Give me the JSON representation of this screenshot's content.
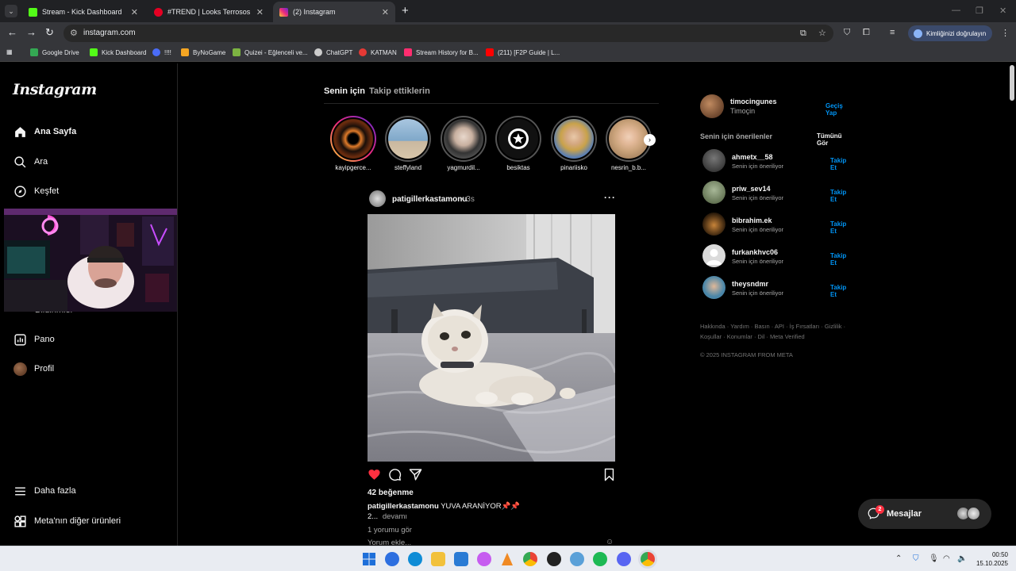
{
  "browser": {
    "tabs": [
      {
        "title": "Stream - Kick Dashboard",
        "favicon_color": "#53fc18",
        "active": false
      },
      {
        "title": "#TREND | Looks Terrosos para",
        "favicon_color": "#e60023",
        "active": false
      },
      {
        "title": "(2) Instagram",
        "favicon_color": "#e1306c",
        "active": true
      }
    ],
    "new_tab": "+",
    "url": "instagram.com",
    "profile_button": "Kimliğinizi doğrulayın",
    "bookmarks": [
      {
        "label": "Google Drive",
        "color": "#34a853"
      },
      {
        "label": "Kick Dashboard",
        "color": "#53fc18"
      },
      {
        "label": "!!!!",
        "color": "#4a6cf7"
      },
      {
        "label": "ByNoGame",
        "color": "#f5a623"
      },
      {
        "label": "Quizei - Eğlenceli ve...",
        "color": "#7cb342"
      },
      {
        "label": "ChatGPT",
        "color": "#cccccc"
      },
      {
        "label": "KATMAN",
        "color": "#e53935"
      },
      {
        "label": "Stream History for B...",
        "color": "#ff2d6f"
      },
      {
        "label": "(211) [F2P Guide | L...",
        "color": "#ff0000"
      }
    ]
  },
  "sidebar": {
    "logo": "Instagram",
    "nav": [
      {
        "label": "Ana Sayfa",
        "icon": "home-icon"
      },
      {
        "label": "Ara",
        "icon": "search-icon"
      },
      {
        "label": "Keşfet",
        "icon": "compass-icon"
      }
    ],
    "hidden_item_label": "Bildirimler",
    "bottom_nav": [
      {
        "label": "Pano",
        "icon": "dashboard-icon"
      },
      {
        "label": "Profil",
        "icon": "profile-avatar"
      }
    ],
    "more": "Daha fazla",
    "meta": "Meta'nın diğer ürünleri"
  },
  "feed": {
    "tabs": [
      "Senin için",
      "Takip ettiklerin"
    ],
    "stories": [
      {
        "name": "kayipgerce...",
        "unseen": true,
        "color": "#d35400"
      },
      {
        "name": "steffyland",
        "unseen": false,
        "color": "#7fa8c9"
      },
      {
        "name": "yagmurdil...",
        "unseen": false,
        "color": "#9a9a9a"
      },
      {
        "name": "besiktas",
        "unseen": false,
        "color": "#111111"
      },
      {
        "name": "pinariisko",
        "unseen": false,
        "color": "#5b7fb3"
      },
      {
        "name": "nesrin_b.b...",
        "unseen": false,
        "color": "#c9a27a"
      }
    ],
    "post": {
      "username": "patigillerkastamonu",
      "time": "3s",
      "likes": "42 beğenme",
      "caption_user": "patigillerkastamonu",
      "caption_text": "YUVA ARANİYOR📌📌",
      "caption_more_prefix": "2...",
      "caption_more_link": "devamı",
      "view_comments": "1 yorumu gör",
      "add_comment_placeholder": "Yorum ekle...",
      "liked": true,
      "heart_color": "#ff3040"
    }
  },
  "right": {
    "me": {
      "handle": "timocingunes",
      "name": "Timoçin",
      "switch": "Geçiş Yap"
    },
    "suggestions_title": "Senin için önerilenler",
    "see_all": "Tümünü Gör",
    "suggestions": [
      {
        "username": "ahmetx__58",
        "sub": "Senin için öneriliyor",
        "action": "Takip Et",
        "color": "#3a3a3a"
      },
      {
        "username": "priw_sev14",
        "sub": "Senin için öneriliyor",
        "action": "Takip Et",
        "color": "#6f8a6a"
      },
      {
        "username": "bibrahim.ek",
        "sub": "Senin için öneriliyor",
        "action": "Takip Et",
        "color": "#a0642a"
      },
      {
        "username": "furkankhvc06",
        "sub": "Senin için öneriliyor",
        "action": "Takip Et",
        "color": "#dbdbdb"
      },
      {
        "username": "theysndmr",
        "sub": "Senin için öneriliyor",
        "action": "Takip Et",
        "color": "#4a86a8"
      }
    ],
    "footer_links": "Hakkında · Yardım · Basın · API · İş Fırsatları · Gizlilik · Koşullar · Konumlar · Dil · Meta Verified",
    "copyright": "© 2025 INSTAGRAM FROM META"
  },
  "messages": {
    "label": "Mesajlar",
    "badge": "2"
  },
  "taskbar": {
    "time": "00:50",
    "date": "15.10.2025",
    "apps": [
      "#1e6fd9",
      "#2d6fe0",
      "#0f8cd6",
      "#f2c13b",
      "#2a7bd4",
      "#c65cf0",
      "#f08a24",
      "#ea4335",
      "#222222",
      "#5aa0d8",
      "#1db954",
      "#5865f2",
      "#ea4335"
    ]
  }
}
